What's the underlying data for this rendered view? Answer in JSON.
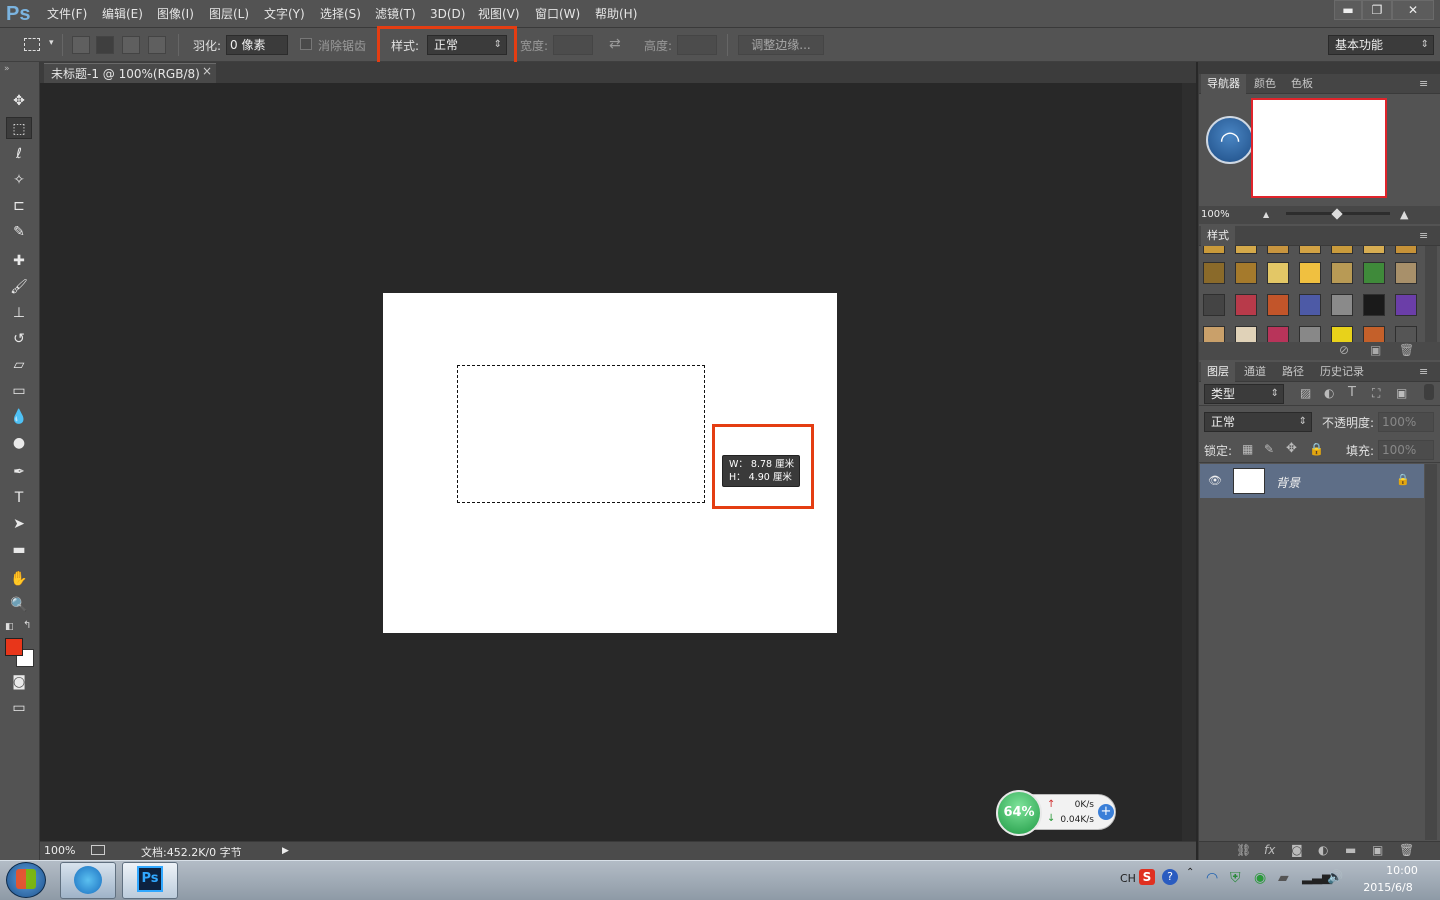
{
  "app": {
    "logo": "Ps"
  },
  "menu": [
    "文件(F)",
    "编辑(E)",
    "图像(I)",
    "图层(L)",
    "文字(Y)",
    "选择(S)",
    "滤镜(T)",
    "3D(D)",
    "视图(V)",
    "窗口(W)",
    "帮助(H)"
  ],
  "window_controls": {
    "minimize": "▬",
    "restore": "❐",
    "close": "✕"
  },
  "options": {
    "feather_label": "羽化:",
    "feather_value": "0 像素",
    "antialias_label": "消除锯齿",
    "style_label": "样式:",
    "style_value": "正常",
    "width_label": "宽度:",
    "swap_icon": "⇄",
    "height_label": "高度:",
    "refine_edge": "调整边缘...",
    "workspace": "基本功能"
  },
  "document": {
    "tab_title": "未标题-1 @ 100%(RGB/8)",
    "close": "×",
    "tooltip_w": "W： 8.78 厘米",
    "tooltip_h": "H： 4.90 厘米"
  },
  "status": {
    "zoom": "100%",
    "doc": "文档:452.2K/0 字节",
    "arrow": "▶"
  },
  "panels": {
    "nav_tabs": [
      "导航器",
      "颜色",
      "色板"
    ],
    "nav_zoom": "100%",
    "styles_tab": "样式",
    "layers_tabs": [
      "图层",
      "通道",
      "路径",
      "历史记录"
    ],
    "kind": "类型",
    "blend": "正常",
    "opacity_label": "不透明度:",
    "opacity_value": "100%",
    "lock_label": "锁定:",
    "fill_label": "填充:",
    "fill_value": "100%",
    "layer_name": "背景",
    "menu_icon": "≡"
  },
  "net_widget": {
    "percent": "64%",
    "up": "0K/s",
    "down": "0.04K/s",
    "up_arrow": "↑",
    "down_arrow": "↓",
    "plus": "+"
  },
  "taskbar": {
    "lang": "CH",
    "time": "10:00",
    "date": "2015/6/8",
    "ps_label": "Ps"
  },
  "colors": {
    "accent_red": "#e43d12",
    "foreground": "#e8361a",
    "layer_selected": "#5e6e87"
  }
}
